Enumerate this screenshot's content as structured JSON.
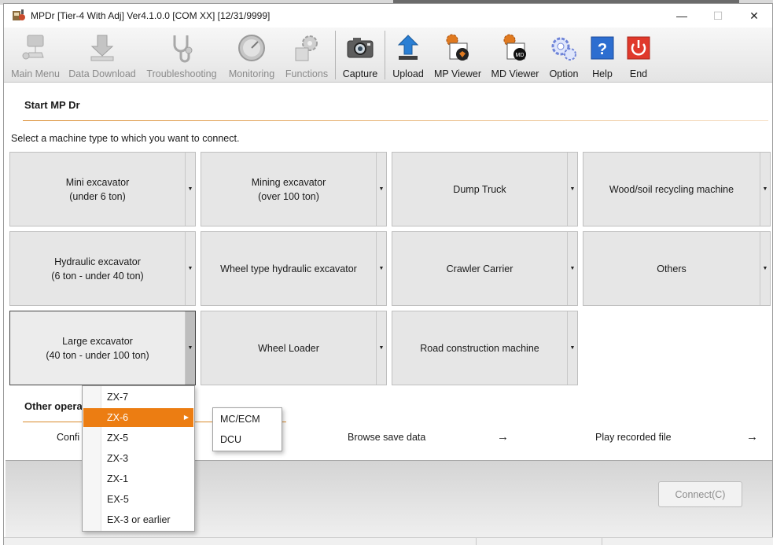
{
  "window": {
    "title": "MPDr [Tier-4 With Adj] Ver4.1.0.0 [COM XX] [12/31/9999]",
    "min": "—",
    "max": "☐",
    "close": "✕"
  },
  "toolbar": [
    {
      "label": "Main Menu",
      "icon": "main-menu-icon",
      "enabled": false
    },
    {
      "label": "Data Download",
      "icon": "download-icon",
      "enabled": false
    },
    {
      "label": "Troubleshooting",
      "icon": "stethoscope-icon",
      "enabled": false
    },
    {
      "label": "Monitoring",
      "icon": "gauge-icon",
      "enabled": false
    },
    {
      "label": "Functions",
      "icon": "functions-gear-icon",
      "enabled": false
    },
    {
      "label": "Capture",
      "icon": "camera-icon",
      "enabled": true
    },
    {
      "label": "Upload",
      "icon": "upload-icon",
      "enabled": true
    },
    {
      "label": "MP Viewer",
      "icon": "mp-viewer-icon",
      "enabled": true
    },
    {
      "label": "MD Viewer",
      "icon": "md-viewer-icon",
      "enabled": true
    },
    {
      "label": "Option",
      "icon": "option-gears-icon",
      "enabled": true
    },
    {
      "label": "Help",
      "icon": "help-icon",
      "enabled": true
    },
    {
      "label": "End",
      "icon": "power-icon",
      "enabled": true
    }
  ],
  "main": {
    "heading": "Start MP Dr",
    "prompt": "Select a machine type to which you want to connect.",
    "machines": [
      {
        "line1": "Mini excavator",
        "line2": "(under 6 ton)"
      },
      {
        "line1": "Mining excavator",
        "line2": "(over 100 ton)"
      },
      {
        "line1": "Dump Truck",
        "line2": ""
      },
      {
        "line1": "Wood/soil recycling machine",
        "line2": ""
      },
      {
        "line1": "Hydraulic excavator",
        "line2": "(6 ton - under 40 ton)"
      },
      {
        "line1": "Wheel type hydraulic excavator",
        "line2": ""
      },
      {
        "line1": "Crawler Carrier",
        "line2": ""
      },
      {
        "line1": "Others",
        "line2": ""
      },
      {
        "line1": "Large excavator",
        "line2": "(40 ton - under 100 ton)"
      },
      {
        "line1": "Wheel Loader",
        "line2": ""
      },
      {
        "line1": "Road construction machine",
        "line2": ""
      }
    ],
    "other_heading": "Other opera",
    "links": {
      "confirm": "Confi",
      "browse": "Browse save data",
      "play": "Play recorded file",
      "arrow": "→"
    }
  },
  "menu": {
    "items": [
      "ZX-7",
      "ZX-6",
      "ZX-5",
      "ZX-3",
      "ZX-1",
      "EX-5",
      "EX-3 or earlier"
    ],
    "selected": "ZX-6",
    "submenu": [
      "MC/ECM",
      "DCU"
    ]
  },
  "footer": {
    "connect": "Connect(C)"
  },
  "colors": {
    "accent": "#ec7d12"
  }
}
